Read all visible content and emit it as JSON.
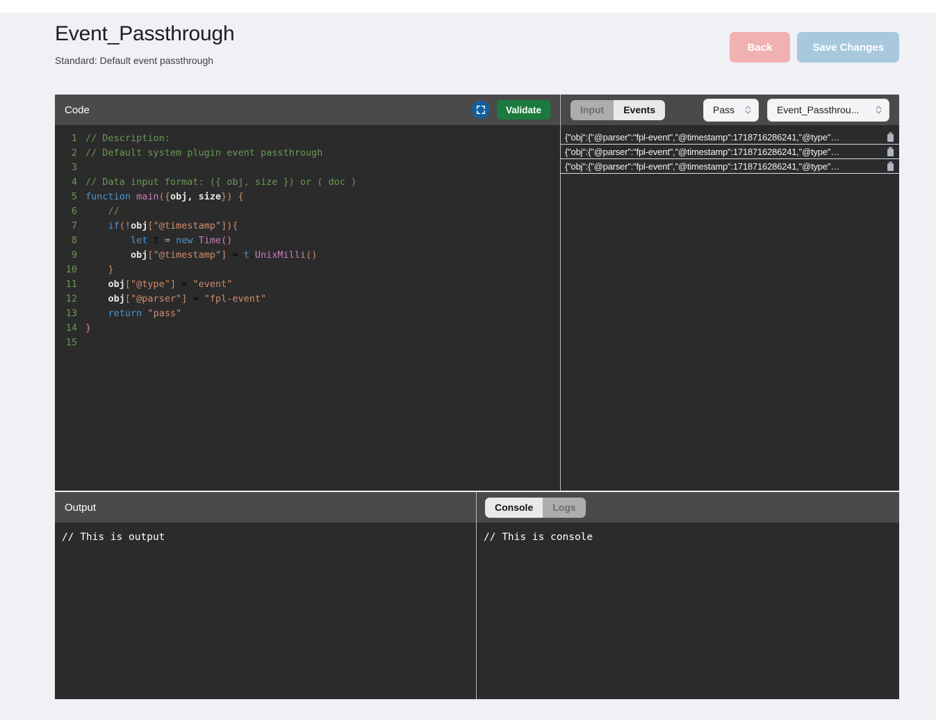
{
  "header": {
    "title": "Event_Passthrough",
    "subtitle": "Standard: Default event passthrough",
    "back_label": "Back",
    "save_label": "Save Changes",
    "back_color": "#f0b1b1",
    "save_color": "#a8c8dd"
  },
  "code_panel": {
    "title": "Code",
    "expand_icon": "fullscreen-expand-icon",
    "validate_label": "Validate",
    "validate_color": "#1b7a3d",
    "lines": [
      {
        "n": "1",
        "tokens": [
          {
            "t": "// Description:",
            "c": "t-com"
          }
        ]
      },
      {
        "n": "2",
        "tokens": [
          {
            "t": "// Default system plugin event passthrough",
            "c": "t-com"
          }
        ]
      },
      {
        "n": "3",
        "tokens": []
      },
      {
        "n": "4",
        "tokens": [
          {
            "t": "// Data input format: ({ obj, size }) or ( doc )",
            "c": "t-com"
          }
        ]
      },
      {
        "n": "5",
        "tokens": [
          {
            "t": "function ",
            "c": "t-kw"
          },
          {
            "t": "main",
            "c": "t-fn"
          },
          {
            "t": "(",
            "c": "t-brk"
          },
          {
            "t": "{",
            "c": "t-op"
          },
          {
            "t": "obj, size",
            "c": "t-var"
          },
          {
            "t": "}",
            "c": "t-op"
          },
          {
            "t": ")",
            "c": "t-brk"
          },
          {
            "t": " ",
            "c": "t-pl"
          },
          {
            "t": "{",
            "c": "t-op"
          }
        ]
      },
      {
        "n": "6",
        "tokens": [
          {
            "t": "    //",
            "c": "t-com"
          }
        ]
      },
      {
        "n": "7",
        "tokens": [
          {
            "t": "    ",
            "c": "t-pl"
          },
          {
            "t": "if",
            "c": "t-kw"
          },
          {
            "t": "(",
            "c": "t-op"
          },
          {
            "t": "!",
            "c": "t-op"
          },
          {
            "t": "obj",
            "c": "t-var"
          },
          {
            "t": "[",
            "c": "t-brk"
          },
          {
            "t": "\"@timestamp\"",
            "c": "t-str"
          },
          {
            "t": "]",
            "c": "t-brk"
          },
          {
            "t": ")",
            "c": "t-op"
          },
          {
            "t": "{",
            "c": "t-op"
          }
        ]
      },
      {
        "n": "8",
        "tokens": [
          {
            "t": "        ",
            "c": "t-pl"
          },
          {
            "t": "let",
            "c": "t-kw"
          },
          {
            "t": " t ",
            "c": "t-lc"
          },
          {
            "t": "=",
            "c": "t-pl"
          },
          {
            "t": " ",
            "c": "t-pl"
          },
          {
            "t": "new",
            "c": "t-kw"
          },
          {
            "t": " ",
            "c": "t-pl"
          },
          {
            "t": "Time",
            "c": "t-fn"
          },
          {
            "t": "()",
            "c": "t-op"
          }
        ]
      },
      {
        "n": "9",
        "tokens": [
          {
            "t": "        ",
            "c": "t-pl"
          },
          {
            "t": "obj",
            "c": "t-var"
          },
          {
            "t": "[",
            "c": "t-brk"
          },
          {
            "t": "\"@timestamp\"",
            "c": "t-str"
          },
          {
            "t": "]",
            "c": "t-brk"
          },
          {
            "t": " = ",
            "c": "t-lc"
          },
          {
            "t": "t",
            "c": "t-kw"
          },
          {
            "t": ".",
            "c": "t-lc"
          },
          {
            "t": "UnixMilli",
            "c": "t-fn"
          },
          {
            "t": "()",
            "c": "t-op"
          }
        ]
      },
      {
        "n": "10",
        "tokens": [
          {
            "t": "    ",
            "c": "t-pl"
          },
          {
            "t": "}",
            "c": "t-op"
          }
        ]
      },
      {
        "n": "11",
        "tokens": [
          {
            "t": "    ",
            "c": "t-pl"
          },
          {
            "t": "obj",
            "c": "t-var"
          },
          {
            "t": "[",
            "c": "t-brk"
          },
          {
            "t": "\"@type\"",
            "c": "t-str"
          },
          {
            "t": "]",
            "c": "t-brk"
          },
          {
            "t": " = ",
            "c": "t-lc"
          },
          {
            "t": "\"event\"",
            "c": "t-str"
          }
        ]
      },
      {
        "n": "12",
        "tokens": [
          {
            "t": "    ",
            "c": "t-pl"
          },
          {
            "t": "obj",
            "c": "t-var"
          },
          {
            "t": "[",
            "c": "t-brk"
          },
          {
            "t": "\"@parser\"",
            "c": "t-str"
          },
          {
            "t": "]",
            "c": "t-brk"
          },
          {
            "t": " = ",
            "c": "t-lc"
          },
          {
            "t": "\"fpl-event\"",
            "c": "t-str"
          }
        ]
      },
      {
        "n": "13",
        "tokens": [
          {
            "t": "    ",
            "c": "t-pl"
          },
          {
            "t": "return",
            "c": "t-kw"
          },
          {
            "t": " ",
            "c": "t-pl"
          },
          {
            "t": "\"pass\"",
            "c": "t-str"
          }
        ]
      },
      {
        "n": "14",
        "tokens": [
          {
            "t": "}",
            "c": "t-op"
          }
        ]
      },
      {
        "n": "15",
        "tokens": []
      }
    ]
  },
  "events_panel": {
    "tabs": [
      {
        "label": "Input",
        "active": false
      },
      {
        "label": "Events",
        "active": true
      }
    ],
    "status_select": {
      "value": "Pass",
      "icon": "chevron-updown-icon"
    },
    "name_select": {
      "value": "Event_Passthrou...",
      "icon": "chevron-updown-icon"
    },
    "rows": [
      {
        "text": "{\"obj\":{\"@parser\":\"fpl-event\",\"@timestamp\":1718716286241,\"@type\"…",
        "delete_icon": "trash-icon"
      },
      {
        "text": "{\"obj\":{\"@parser\":\"fpl-event\",\"@timestamp\":1718716286241,\"@type\"…",
        "delete_icon": "trash-icon"
      },
      {
        "text": "{\"obj\":{\"@parser\":\"fpl-event\",\"@timestamp\":1718716286241,\"@type\"…",
        "delete_icon": "trash-icon"
      }
    ]
  },
  "output_panel": {
    "title": "Output",
    "content": "// This is output"
  },
  "console_panel": {
    "tabs": [
      {
        "label": "Console",
        "active": true
      },
      {
        "label": "Logs",
        "active": false
      }
    ],
    "content": "// This is console"
  }
}
